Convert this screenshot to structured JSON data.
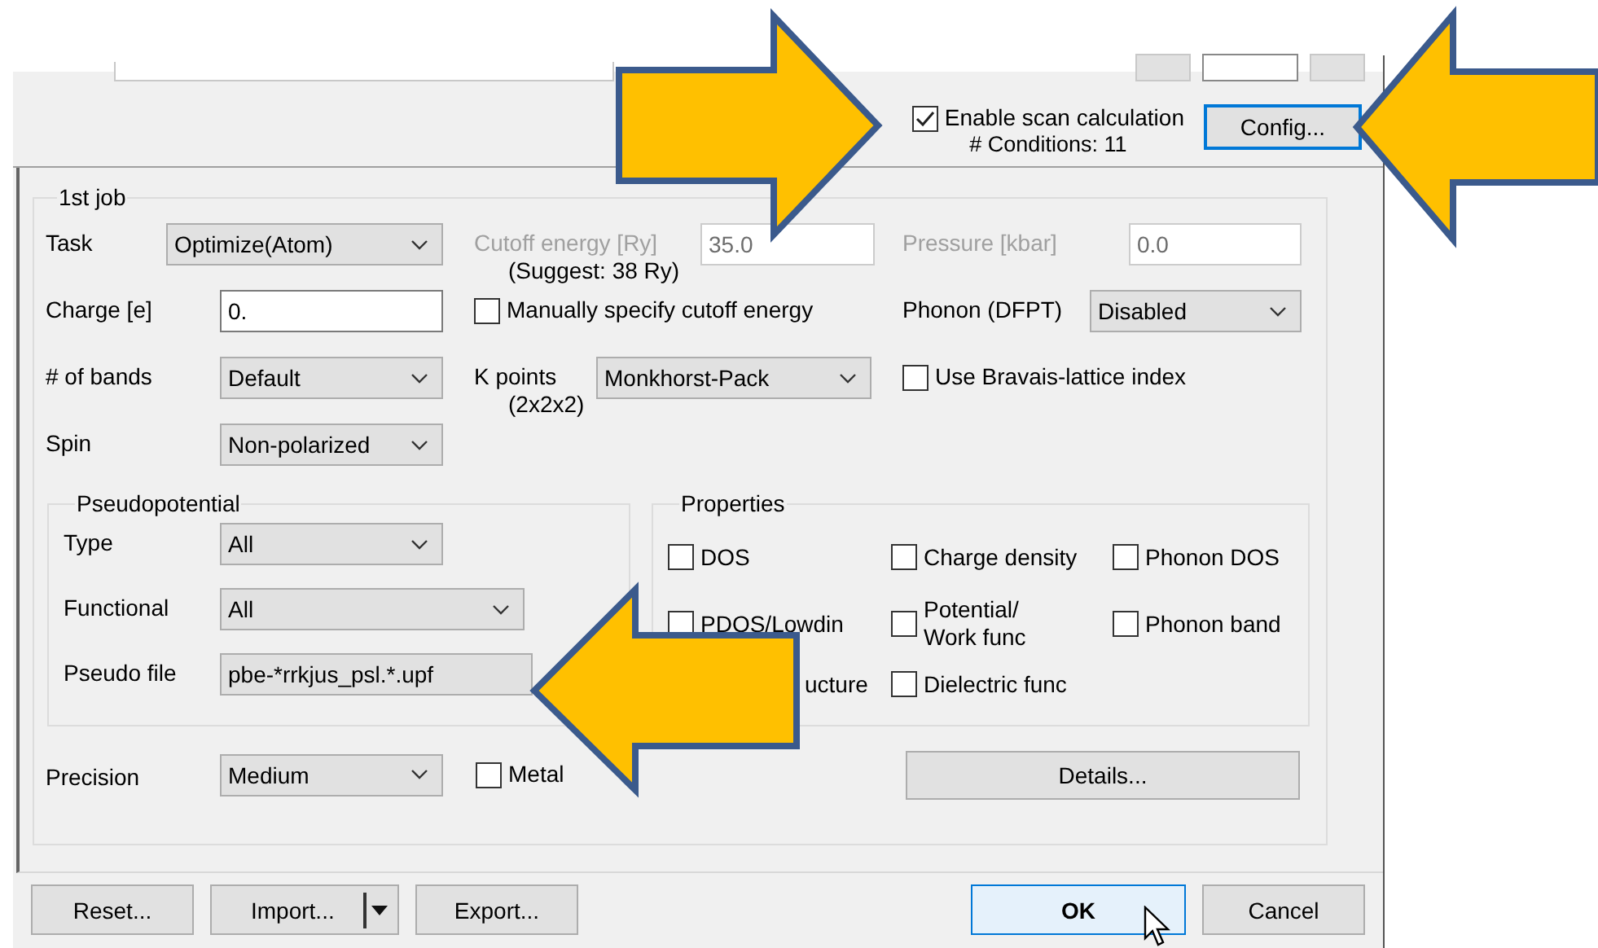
{
  "scan": {
    "enable": {
      "label": "Enable scan calculation",
      "checked": true
    },
    "conditions": "# Conditions: 11",
    "config_button": {
      "label": "Config...",
      "focused": true
    }
  },
  "job": {
    "title": "1st job",
    "task": {
      "label": "Task",
      "value": "Optimize(Atom)"
    },
    "cutoff": {
      "label": "Cutoff energy [Ry]",
      "hint": "(Suggest: 38 Ry)",
      "value": "35.0",
      "disabled": true
    },
    "pressure": {
      "label": "Pressure [kbar]",
      "value": "0.0",
      "disabled": true
    },
    "charge": {
      "label": "Charge [e]",
      "value": "0."
    },
    "manual_cutoff": {
      "label": "Manually specify cutoff energy",
      "checked": false
    },
    "phonon": {
      "label": "Phonon (DFPT)",
      "value": "Disabled"
    },
    "bands": {
      "label": "# of bands",
      "value": "Default"
    },
    "kpoints": {
      "label": "K points",
      "hint": "(2x2x2)",
      "value": "Monkhorst-Pack"
    },
    "bravais": {
      "label": "Use Bravais-lattice index",
      "checked": false
    },
    "spin": {
      "label": "Spin",
      "value": "Non-polarized"
    },
    "pseudopotential": {
      "title": "Pseudopotential",
      "rows": [
        {
          "kind": "dropdown",
          "label": "Type",
          "value": "All"
        },
        {
          "kind": "dropdown",
          "label": "Functional",
          "value": "All"
        },
        {
          "kind": "covered_dropdown",
          "label": "Pseudo file",
          "value": "pbe-*rrkjus_psl.*.upf"
        }
      ]
    },
    "properties": {
      "title": "Properties",
      "items": [
        {
          "kind": "checkbox",
          "label": "DOS",
          "checked": false
        },
        {
          "kind": "checkbox",
          "label": "Charge density",
          "checked": false
        },
        {
          "kind": "checkbox",
          "label": "Phonon DOS",
          "checked": false
        },
        {
          "kind": "checkbox",
          "label": "PDOS/Lowdin",
          "checked": false
        },
        {
          "kind": "checkbox",
          "label": "Potential/\nWork func",
          "checked": false
        },
        {
          "kind": "checkbox",
          "label": "Phonon band",
          "checked": false
        },
        {
          "kind": "text",
          "label": "ucture"
        },
        {
          "kind": "checkbox",
          "label": "Dielectric func",
          "checked": false
        }
      ]
    },
    "precision": {
      "label": "Precision",
      "value": "Medium"
    },
    "metal": {
      "label": "Metal",
      "checked": false
    },
    "details_button": "Details..."
  },
  "buttons_left": [
    {
      "label": "Reset...",
      "kind": "plain"
    },
    {
      "label": "Import...",
      "kind": "split"
    },
    {
      "label": "Export...",
      "kind": "plain"
    }
  ],
  "buttons_right": [
    {
      "label": "OK",
      "kind": "default"
    },
    {
      "label": "Cancel",
      "kind": "plain"
    }
  ]
}
